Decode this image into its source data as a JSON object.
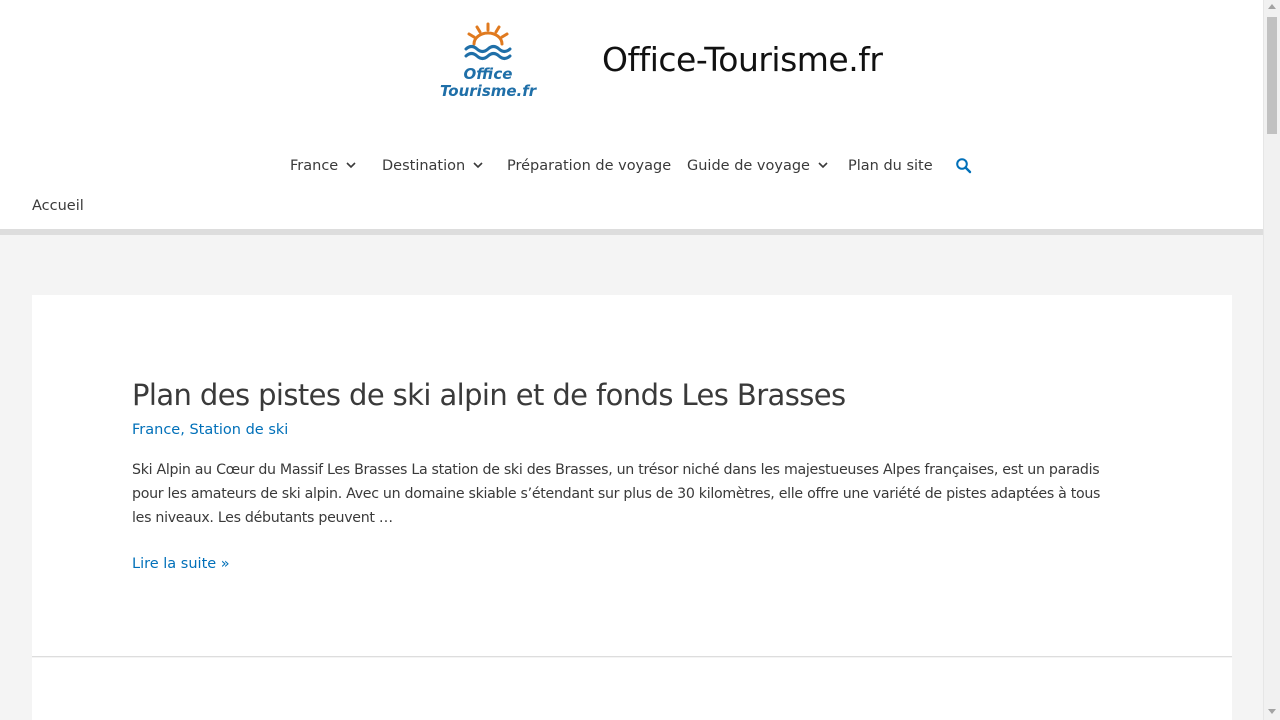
{
  "header": {
    "logo_line1": "Office",
    "logo_line2": "Tourisme.fr",
    "site_title": "Office-Tourisme.fr"
  },
  "nav": {
    "items": [
      {
        "label": "France",
        "has_dropdown": true
      },
      {
        "label": "Destination",
        "has_dropdown": true
      },
      {
        "label": "Préparation de voyage",
        "has_dropdown": false
      },
      {
        "label": "Guide de voyage",
        "has_dropdown": true
      },
      {
        "label": "Plan du site",
        "has_dropdown": false
      }
    ],
    "search_icon": "search-icon"
  },
  "breadcrumb": {
    "home": "Accueil"
  },
  "post": {
    "title": "Plan des pistes de ski alpin et de fonds Les Brasses",
    "categories": [
      "France",
      "Station de ski"
    ],
    "category_separator": ", ",
    "excerpt": "Ski Alpin au Cœur du Massif Les Brasses La station de ski des Brasses, un trésor niché dans les majestueuses Alpes françaises, est un paradis pour les amateurs de ski alpin. Avec un domaine skiable s’étendant sur plus de 30 kilomètres, elle offre une variété de pistes adaptées à tous les niveaux. Les débutants peuvent …",
    "read_more": "Lire la suite »"
  },
  "colors": {
    "link": "#0170b9",
    "text": "#3a3a3a",
    "background": "#f4f4f4",
    "logo_orange": "#e07a1f",
    "logo_blue": "#1f6fa8"
  }
}
